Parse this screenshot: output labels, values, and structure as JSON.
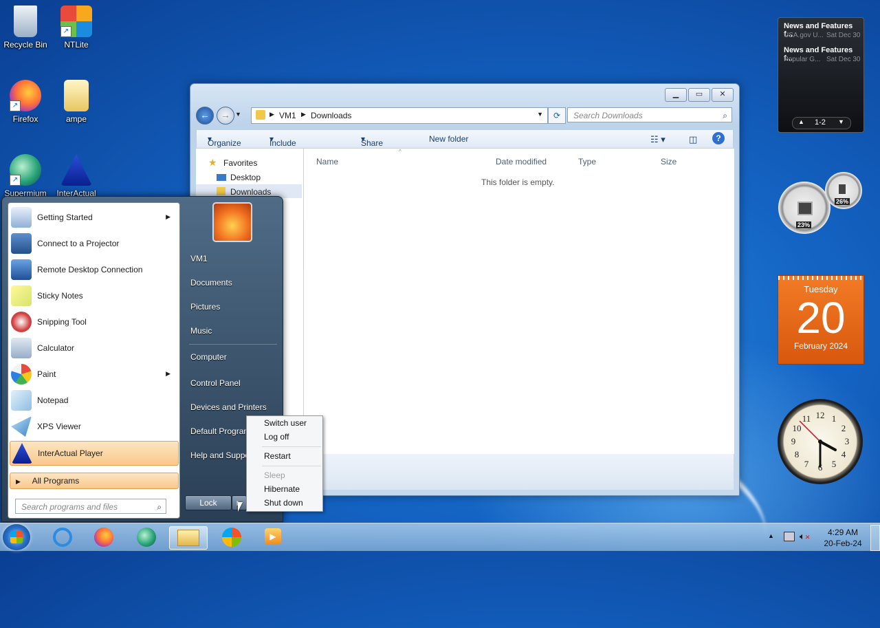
{
  "desktop": {
    "icons": [
      {
        "label": "Recycle Bin"
      },
      {
        "label": "NTLite"
      },
      {
        "label": "Firefox"
      },
      {
        "label": "ampe"
      },
      {
        "label": "Supermium"
      },
      {
        "label": "InterActual"
      }
    ]
  },
  "explorer": {
    "address": {
      "segments": [
        "VM1",
        "Downloads"
      ]
    },
    "search_placeholder": "Search Downloads",
    "toolbar": {
      "organize": "Organize",
      "include": "Include in library",
      "share": "Share with",
      "new_folder": "New folder"
    },
    "nav": {
      "favorites": "Favorites",
      "desktop": "Desktop",
      "downloads": "Downloads"
    },
    "columns": [
      "Name",
      "Date modified",
      "Type",
      "Size"
    ],
    "empty_message": "This folder is empty."
  },
  "start_menu": {
    "programs": [
      {
        "label": "Getting Started",
        "submenu": true
      },
      {
        "label": "Connect to a Projector",
        "submenu": false
      },
      {
        "label": "Remote Desktop Connection",
        "submenu": false
      },
      {
        "label": "Sticky Notes",
        "submenu": false
      },
      {
        "label": "Snipping Tool",
        "submenu": false
      },
      {
        "label": "Calculator",
        "submenu": false
      },
      {
        "label": "Paint",
        "submenu": true
      },
      {
        "label": "Notepad",
        "submenu": false
      },
      {
        "label": "XPS Viewer",
        "submenu": false
      },
      {
        "label": "InterActual Player",
        "submenu": false
      }
    ],
    "all_programs": "All Programs",
    "search_placeholder": "Search programs and files",
    "right": {
      "user": "VM1",
      "documents": "Documents",
      "pictures": "Pictures",
      "music": "Music",
      "computer": "Computer",
      "control_panel": "Control Panel",
      "devices": "Devices and Printers",
      "default_programs": "Default Programs",
      "help": "Help and Support"
    },
    "lock": "Lock",
    "power_menu": {
      "switch_user": "Switch user",
      "log_off": "Log off",
      "restart": "Restart",
      "sleep": "Sleep",
      "hibernate": "Hibernate",
      "shut_down": "Shut down"
    }
  },
  "gadgets": {
    "feed": [
      {
        "title": "News and Features f...",
        "source": "USA.gov U...",
        "date": "Sat Dec 30"
      },
      {
        "title": "News and Features f...",
        "source": "Popular G...",
        "date": "Sat Dec 30"
      }
    ],
    "feed_pager": "1-2",
    "meters": {
      "cpu": "23%",
      "memory": "26%"
    },
    "calendar": {
      "weekday": "Tuesday",
      "day": "20",
      "month_year": "February 2024"
    }
  },
  "taskbar": {
    "time": "4:29 AM",
    "date": "20-Feb-24"
  }
}
